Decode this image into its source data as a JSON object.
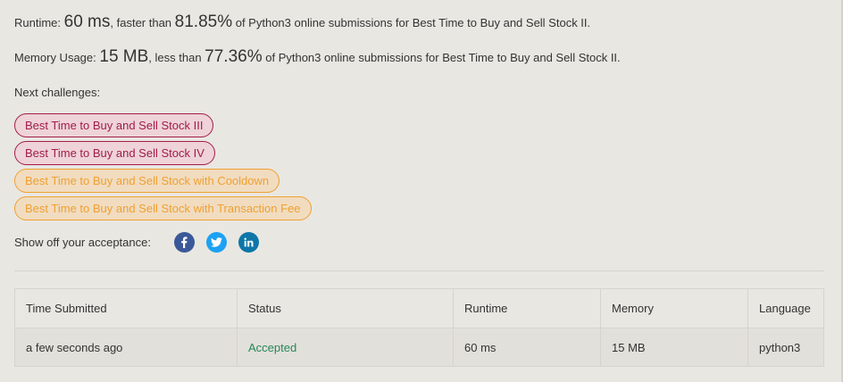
{
  "stats": {
    "runtime_label": "Runtime: ",
    "runtime_value": "60 ms",
    "runtime_mid": ", faster than ",
    "runtime_percent": "81.85%",
    "runtime_suffix": " of Python3 online submissions for Best Time to Buy and Sell Stock II.",
    "memory_label": "Memory Usage: ",
    "memory_value": "15 MB",
    "memory_mid": ", less than ",
    "memory_percent": "77.36%",
    "memory_suffix": " of Python3 online submissions for Best Time to Buy and Sell Stock II."
  },
  "next": {
    "label": "Next challenges:",
    "challenges": [
      {
        "label": "Best Time to Buy and Sell Stock III",
        "difficulty": "hard"
      },
      {
        "label": "Best Time to Buy and Sell Stock IV",
        "difficulty": "hard"
      },
      {
        "label": "Best Time to Buy and Sell Stock with Cooldown",
        "difficulty": "medium"
      },
      {
        "label": "Best Time to Buy and Sell Stock with Transaction Fee",
        "difficulty": "medium"
      }
    ]
  },
  "share": {
    "label": "Show off your acceptance:",
    "icons": [
      "facebook-icon",
      "twitter-icon",
      "linkedin-icon"
    ]
  },
  "colors": {
    "hard": "#a31c4a",
    "medium": "#f0a030",
    "accepted": "#26875b",
    "facebook": "#3b5998",
    "twitter": "#1da1f2",
    "linkedin": "#0e76a8"
  },
  "table": {
    "headers": [
      "Time Submitted",
      "Status",
      "Runtime",
      "Memory",
      "Language"
    ],
    "rows": [
      {
        "time": "a few seconds ago",
        "status": "Accepted",
        "runtime": "60 ms",
        "memory": "15 MB",
        "language": "python3"
      }
    ]
  }
}
